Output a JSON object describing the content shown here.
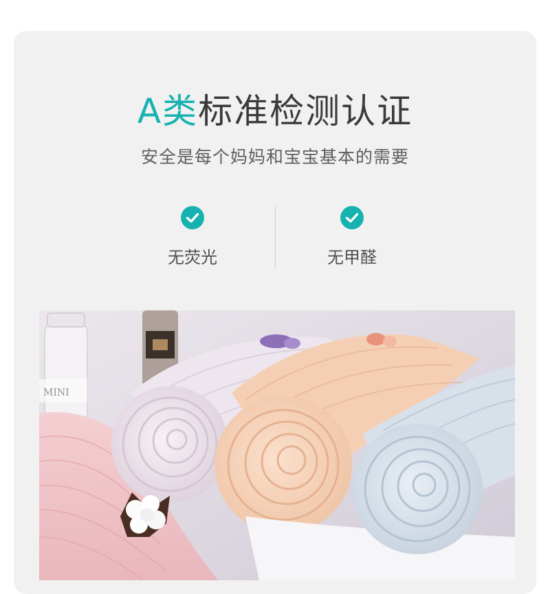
{
  "heading": {
    "accent": "A类",
    "rest": "标准检测认证"
  },
  "subtitle": "安全是每个妈妈和宝宝基本的需要",
  "features": [
    {
      "label": "无荧光",
      "icon": "check-circle-icon"
    },
    {
      "label": "无甲醛",
      "icon": "check-circle-icon"
    }
  ],
  "photo": {
    "jar_label": "MINI",
    "subject": "rolled-baby-muslin-towels"
  },
  "colors": {
    "accent": "#16b2b0",
    "card_background": "#f1f1f1",
    "heading_text": "#3a3a3a",
    "body_text": "#5e5e5e"
  }
}
